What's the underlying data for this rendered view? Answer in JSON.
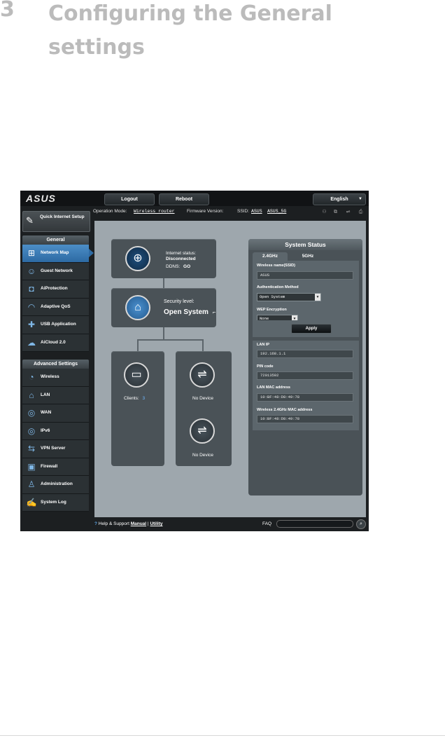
{
  "doc": {
    "section_number": "3",
    "title": "Configuring the General settings"
  },
  "router": {
    "brand": "ASUS",
    "topbar": {
      "logout": "Logout",
      "reboot": "Reboot",
      "language": "English"
    },
    "opbar": {
      "operation_mode_label": "Operation Mode:",
      "operation_mode_value": "Wireless router",
      "firmware_label": "Firmware Version:",
      "ssid_label": "SSID:",
      "ssid_1": "ASUS",
      "ssid_2": "ASUS_5G"
    },
    "sidebar": {
      "quick_setup": "Quick Internet Setup",
      "general_header": "General",
      "general_items": [
        "Network Map",
        "Guest Network",
        "AiProtection",
        "Adaptive QoS",
        "USB Application",
        "AiCloud 2.0"
      ],
      "advanced_header": "Advanced Settings",
      "advanced_items": [
        "Wireless",
        "LAN",
        "WAN",
        "IPv6",
        "VPN Server",
        "Firewall",
        "Administration",
        "System Log"
      ]
    },
    "map": {
      "internet_status_label": "Internet status:",
      "internet_status_value": "Disconnected",
      "ddns_label": "DDNS:",
      "ddns_value": "GO",
      "security_level_label": "Security level:",
      "security_level_value": "Open System",
      "clients_label": "Clients:",
      "clients_count": "3",
      "usb_1": "No Device",
      "usb_2": "No Device"
    },
    "status": {
      "title": "System Status",
      "tab_24": "2.4GHz",
      "tab_5": "5GHz",
      "ssid_label": "Wireless name(SSID)",
      "ssid_value": "ASUS",
      "auth_label": "Authentication Method",
      "auth_value": "Open System",
      "wep_label": "WEP Encryption",
      "wep_value": "None",
      "apply": "Apply",
      "lan_ip_label": "LAN IP",
      "lan_ip_value": "192.168.1.1",
      "pin_label": "PIN code",
      "pin_value": "72013502",
      "lan_mac_label": "LAN MAC address",
      "lan_mac_value": "10:BF:48:D8:49:78",
      "wl_mac_label": "Wireless 2.4GHz MAC address",
      "wl_mac_value": "10:BF:48:D8:49:78"
    },
    "footer": {
      "help": "Help & Support",
      "manual": "Manual",
      "sep": "|",
      "utility": "Utility",
      "faq": "FAQ"
    }
  }
}
